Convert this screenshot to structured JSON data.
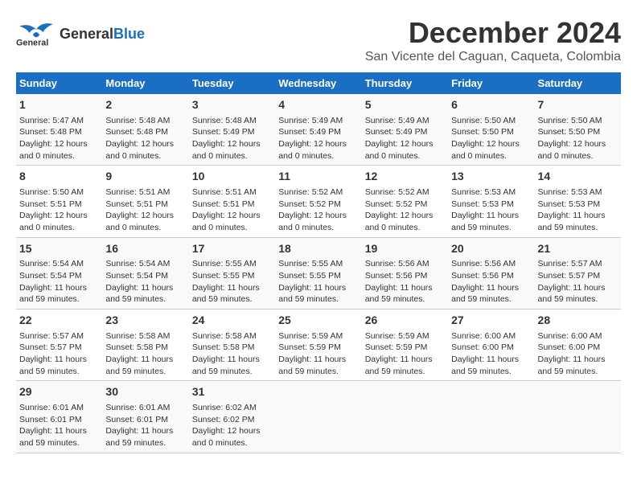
{
  "logo": {
    "part1": "General",
    "part2": "Blue"
  },
  "title": "December 2024",
  "subtitle": "San Vicente del Caguan, Caqueta, Colombia",
  "days": [
    "Sunday",
    "Monday",
    "Tuesday",
    "Wednesday",
    "Thursday",
    "Friday",
    "Saturday"
  ],
  "weeks": [
    [
      {
        "num": "1",
        "sunrise": "Sunrise: 5:47 AM",
        "sunset": "Sunset: 5:48 PM",
        "daylight": "Daylight: 12 hours and 0 minutes."
      },
      {
        "num": "2",
        "sunrise": "Sunrise: 5:48 AM",
        "sunset": "Sunset: 5:48 PM",
        "daylight": "Daylight: 12 hours and 0 minutes."
      },
      {
        "num": "3",
        "sunrise": "Sunrise: 5:48 AM",
        "sunset": "Sunset: 5:49 PM",
        "daylight": "Daylight: 12 hours and 0 minutes."
      },
      {
        "num": "4",
        "sunrise": "Sunrise: 5:49 AM",
        "sunset": "Sunset: 5:49 PM",
        "daylight": "Daylight: 12 hours and 0 minutes."
      },
      {
        "num": "5",
        "sunrise": "Sunrise: 5:49 AM",
        "sunset": "Sunset: 5:49 PM",
        "daylight": "Daylight: 12 hours and 0 minutes."
      },
      {
        "num": "6",
        "sunrise": "Sunrise: 5:50 AM",
        "sunset": "Sunset: 5:50 PM",
        "daylight": "Daylight: 12 hours and 0 minutes."
      },
      {
        "num": "7",
        "sunrise": "Sunrise: 5:50 AM",
        "sunset": "Sunset: 5:50 PM",
        "daylight": "Daylight: 12 hours and 0 minutes."
      }
    ],
    [
      {
        "num": "8",
        "sunrise": "Sunrise: 5:50 AM",
        "sunset": "Sunset: 5:51 PM",
        "daylight": "Daylight: 12 hours and 0 minutes."
      },
      {
        "num": "9",
        "sunrise": "Sunrise: 5:51 AM",
        "sunset": "Sunset: 5:51 PM",
        "daylight": "Daylight: 12 hours and 0 minutes."
      },
      {
        "num": "10",
        "sunrise": "Sunrise: 5:51 AM",
        "sunset": "Sunset: 5:51 PM",
        "daylight": "Daylight: 12 hours and 0 minutes."
      },
      {
        "num": "11",
        "sunrise": "Sunrise: 5:52 AM",
        "sunset": "Sunset: 5:52 PM",
        "daylight": "Daylight: 12 hours and 0 minutes."
      },
      {
        "num": "12",
        "sunrise": "Sunrise: 5:52 AM",
        "sunset": "Sunset: 5:52 PM",
        "daylight": "Daylight: 12 hours and 0 minutes."
      },
      {
        "num": "13",
        "sunrise": "Sunrise: 5:53 AM",
        "sunset": "Sunset: 5:53 PM",
        "daylight": "Daylight: 11 hours and 59 minutes."
      },
      {
        "num": "14",
        "sunrise": "Sunrise: 5:53 AM",
        "sunset": "Sunset: 5:53 PM",
        "daylight": "Daylight: 11 hours and 59 minutes."
      }
    ],
    [
      {
        "num": "15",
        "sunrise": "Sunrise: 5:54 AM",
        "sunset": "Sunset: 5:54 PM",
        "daylight": "Daylight: 11 hours and 59 minutes."
      },
      {
        "num": "16",
        "sunrise": "Sunrise: 5:54 AM",
        "sunset": "Sunset: 5:54 PM",
        "daylight": "Daylight: 11 hours and 59 minutes."
      },
      {
        "num": "17",
        "sunrise": "Sunrise: 5:55 AM",
        "sunset": "Sunset: 5:55 PM",
        "daylight": "Daylight: 11 hours and 59 minutes."
      },
      {
        "num": "18",
        "sunrise": "Sunrise: 5:55 AM",
        "sunset": "Sunset: 5:55 PM",
        "daylight": "Daylight: 11 hours and 59 minutes."
      },
      {
        "num": "19",
        "sunrise": "Sunrise: 5:56 AM",
        "sunset": "Sunset: 5:56 PM",
        "daylight": "Daylight: 11 hours and 59 minutes."
      },
      {
        "num": "20",
        "sunrise": "Sunrise: 5:56 AM",
        "sunset": "Sunset: 5:56 PM",
        "daylight": "Daylight: 11 hours and 59 minutes."
      },
      {
        "num": "21",
        "sunrise": "Sunrise: 5:57 AM",
        "sunset": "Sunset: 5:57 PM",
        "daylight": "Daylight: 11 hours and 59 minutes."
      }
    ],
    [
      {
        "num": "22",
        "sunrise": "Sunrise: 5:57 AM",
        "sunset": "Sunset: 5:57 PM",
        "daylight": "Daylight: 11 hours and 59 minutes."
      },
      {
        "num": "23",
        "sunrise": "Sunrise: 5:58 AM",
        "sunset": "Sunset: 5:58 PM",
        "daylight": "Daylight: 11 hours and 59 minutes."
      },
      {
        "num": "24",
        "sunrise": "Sunrise: 5:58 AM",
        "sunset": "Sunset: 5:58 PM",
        "daylight": "Daylight: 11 hours and 59 minutes."
      },
      {
        "num": "25",
        "sunrise": "Sunrise: 5:59 AM",
        "sunset": "Sunset: 5:59 PM",
        "daylight": "Daylight: 11 hours and 59 minutes."
      },
      {
        "num": "26",
        "sunrise": "Sunrise: 5:59 AM",
        "sunset": "Sunset: 5:59 PM",
        "daylight": "Daylight: 11 hours and 59 minutes."
      },
      {
        "num": "27",
        "sunrise": "Sunrise: 6:00 AM",
        "sunset": "Sunset: 6:00 PM",
        "daylight": "Daylight: 11 hours and 59 minutes."
      },
      {
        "num": "28",
        "sunrise": "Sunrise: 6:00 AM",
        "sunset": "Sunset: 6:00 PM",
        "daylight": "Daylight: 11 hours and 59 minutes."
      }
    ],
    [
      {
        "num": "29",
        "sunrise": "Sunrise: 6:01 AM",
        "sunset": "Sunset: 6:01 PM",
        "daylight": "Daylight: 11 hours and 59 minutes."
      },
      {
        "num": "30",
        "sunrise": "Sunrise: 6:01 AM",
        "sunset": "Sunset: 6:01 PM",
        "daylight": "Daylight: 11 hours and 59 minutes."
      },
      {
        "num": "31",
        "sunrise": "Sunrise: 6:02 AM",
        "sunset": "Sunset: 6:02 PM",
        "daylight": "Daylight: 12 hours and 0 minutes."
      },
      {
        "num": "",
        "sunrise": "",
        "sunset": "",
        "daylight": ""
      },
      {
        "num": "",
        "sunrise": "",
        "sunset": "",
        "daylight": ""
      },
      {
        "num": "",
        "sunrise": "",
        "sunset": "",
        "daylight": ""
      },
      {
        "num": "",
        "sunrise": "",
        "sunset": "",
        "daylight": ""
      }
    ]
  ]
}
